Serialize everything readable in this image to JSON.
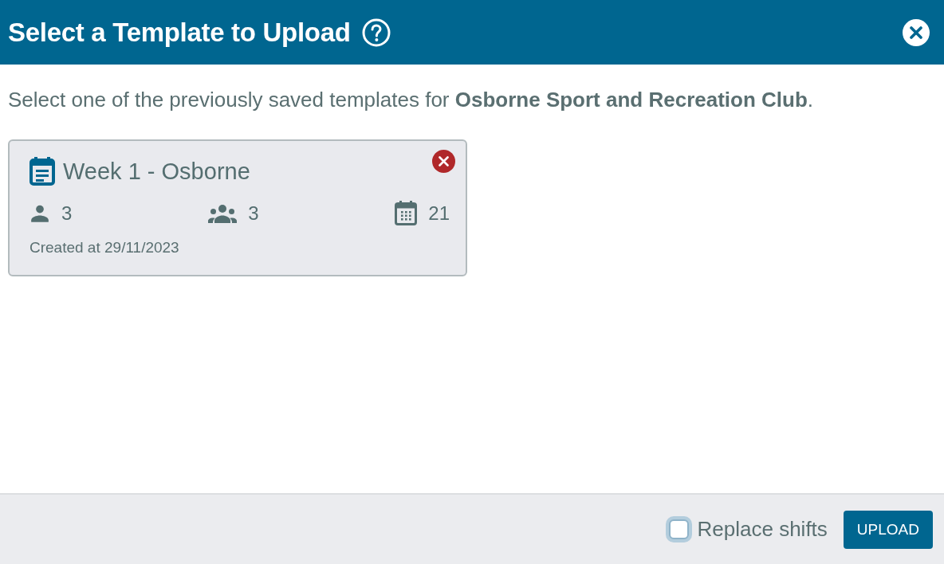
{
  "dialog": {
    "title": "Select a Template to Upload"
  },
  "intro": "Select one of the previously saved templates for **Osborne Sport and Recreation Club**.",
  "templates": [
    {
      "name": "Week 1 - Osborne",
      "selected": false,
      "stats": [
        {
          "kind": "people",
          "value": "3"
        },
        {
          "kind": "groups",
          "value": "3"
        },
        {
          "kind": "days",
          "value": "21"
        }
      ],
      "created": "Created at 29/11/2023"
    }
  ],
  "footer": {
    "replace_shifts": {
      "label": "Replace shifts",
      "checked": false
    },
    "upload_button": "UPLOAD"
  }
}
